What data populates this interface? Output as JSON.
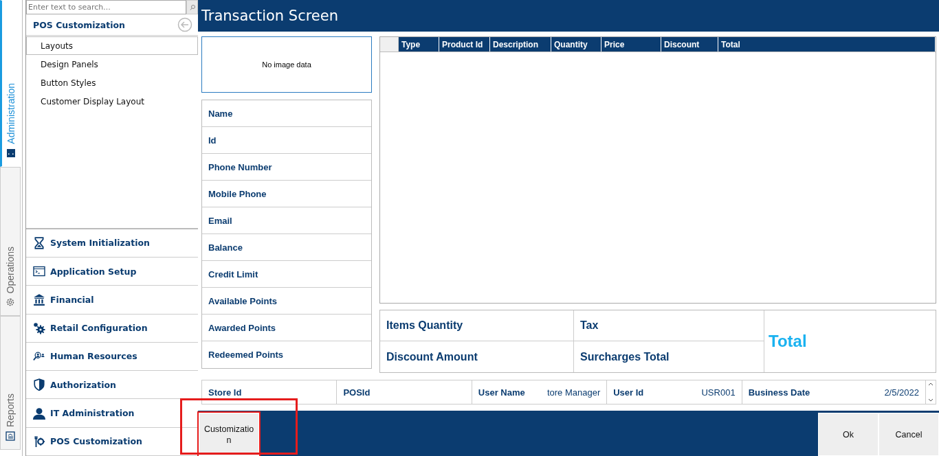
{
  "side_tabs": [
    {
      "label": "Administration",
      "kind": "admin",
      "selected": true
    },
    {
      "label": "Operations",
      "kind": "operations",
      "selected": false
    },
    {
      "label": "Reports",
      "kind": "reports",
      "selected": false
    }
  ],
  "sidebar": {
    "search": {
      "placeholder": "Enter text to search..."
    },
    "title": "POS Customization",
    "items": [
      {
        "label": "Layouts",
        "selected": true
      },
      {
        "label": "Design Panels",
        "selected": false
      },
      {
        "label": "Button Styles",
        "selected": false
      },
      {
        "label": "Customer Display Layout",
        "selected": false
      }
    ],
    "groups": [
      {
        "label": "System Initialization",
        "kind": "hourglass"
      },
      {
        "label": "Application Setup",
        "kind": "terminal"
      },
      {
        "label": "Financial",
        "kind": "bank"
      },
      {
        "label": "Retail Configuration",
        "kind": "gears"
      },
      {
        "label": "Human Resources",
        "kind": "people-search"
      },
      {
        "label": "Authorization",
        "kind": "shield"
      },
      {
        "label": "IT Administration",
        "kind": "person"
      },
      {
        "label": "POS Customization",
        "kind": "wrench-gear"
      }
    ]
  },
  "window": {
    "title": "Transaction Screen"
  },
  "image_box": {
    "text": "No image data"
  },
  "customer_fields": [
    "Name",
    "Id",
    "Phone Number",
    "Mobile Phone",
    "Email",
    "Balance",
    "Credit Limit",
    "Available Points",
    "Awarded Points",
    "Redeemed Points"
  ],
  "table": {
    "columns": [
      "Type",
      "Product Id",
      "Description",
      "Quantity",
      "Price",
      "Discount",
      "Total"
    ]
  },
  "summary": {
    "items_quantity": "Items Quantity",
    "tax": "Tax",
    "discount_amount": "Discount Amount",
    "surcharges_total": "Surcharges Total",
    "total": "Total"
  },
  "status_bar": [
    {
      "label": "Store Id"
    },
    {
      "label": "POSId"
    },
    {
      "label": "User Name",
      "value": "tore Manager"
    },
    {
      "label": "User Id",
      "value": "USR001"
    },
    {
      "label": "Business Date",
      "value": "2/5/2022"
    }
  ],
  "buttons": [
    {
      "label": "Customization",
      "highlighted": true
    },
    {
      "label": "Ok",
      "highlighted": false
    },
    {
      "label": "Cancel",
      "highlighted": false
    }
  ]
}
